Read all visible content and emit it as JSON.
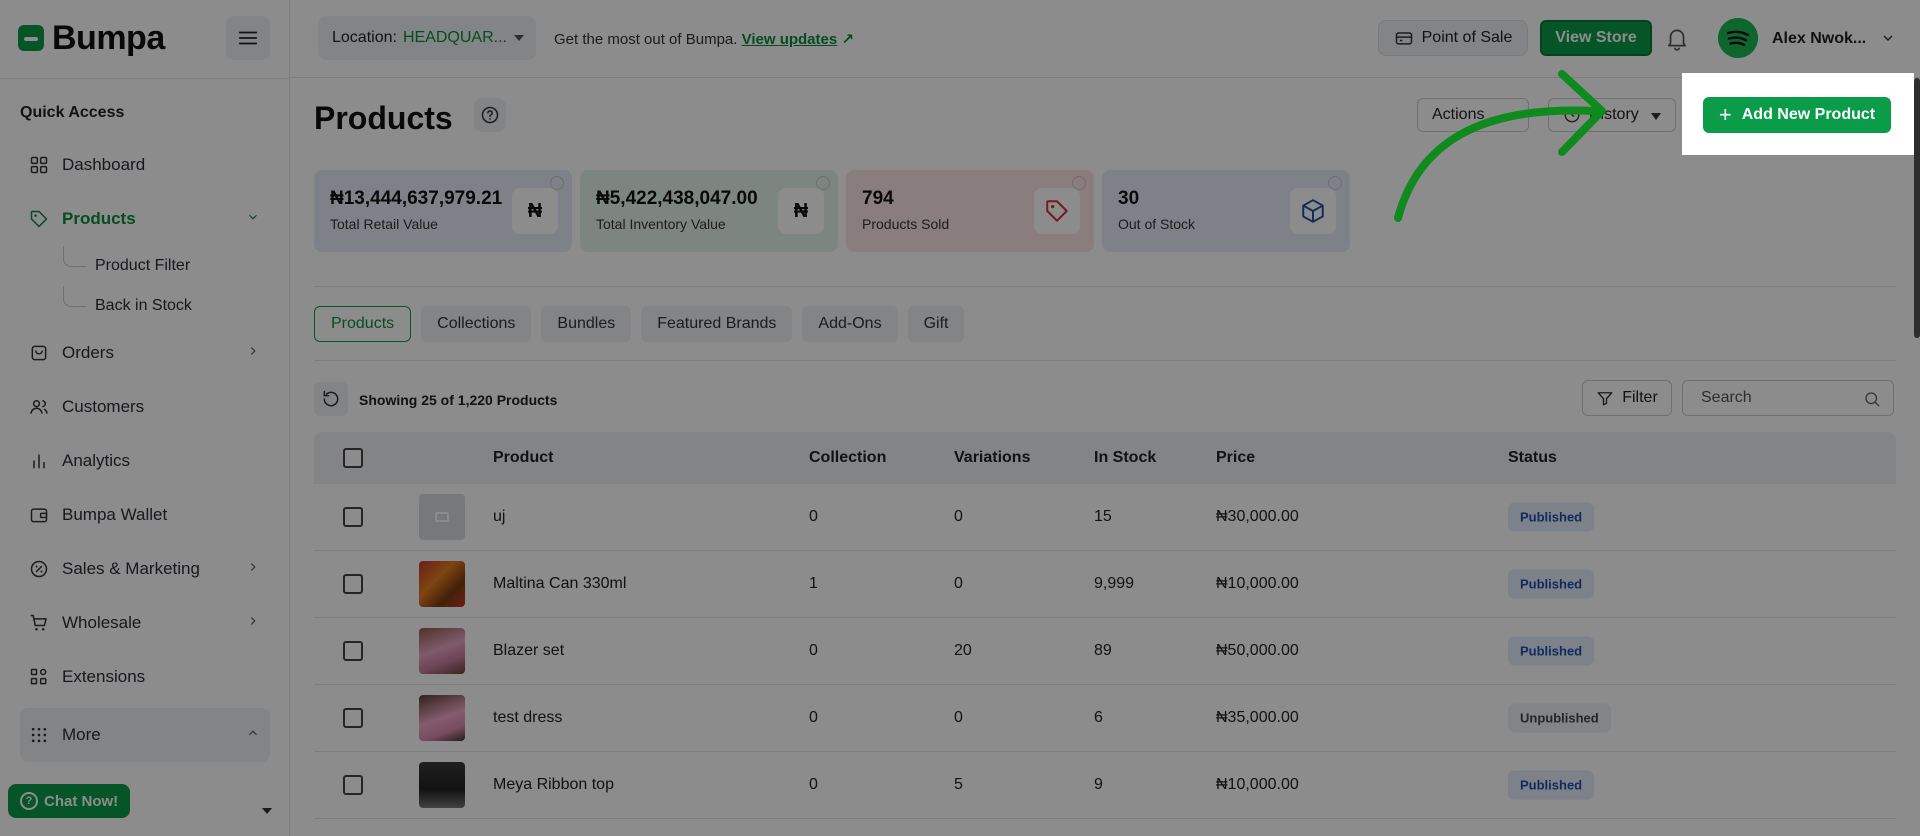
{
  "brand": {
    "name": "Bumpa"
  },
  "sidebar": {
    "quick_access_title": "Quick Access",
    "items": [
      {
        "label": "Dashboard",
        "icon": "grid-icon"
      },
      {
        "label": "Products",
        "icon": "tag-icon",
        "active": true
      },
      {
        "label": "Orders",
        "icon": "orders-icon"
      },
      {
        "label": "Customers",
        "icon": "users-icon"
      },
      {
        "label": "Analytics",
        "icon": "bar-chart-icon"
      },
      {
        "label": "Bumpa Wallet",
        "icon": "wallet-icon"
      },
      {
        "label": "Sales & Marketing",
        "icon": "percent-icon"
      },
      {
        "label": "Wholesale",
        "icon": "cart-icon"
      },
      {
        "label": "Extensions",
        "icon": "extensions-icon"
      },
      {
        "label": "More",
        "icon": "dots-grid-icon"
      }
    ],
    "sub_items": [
      "Product Filter",
      "Back in Stock"
    ],
    "chat_label": "Chat Now!"
  },
  "topbar": {
    "location_label": "Location:",
    "location_value": "HEADQUAR...",
    "promo_text": "Get the most out of Bumpa.",
    "promo_link": "View updates",
    "promo_arrow": "↗",
    "pos_label": "Point of Sale",
    "view_store_label": "View Store",
    "user_name": "Alex Nwok..."
  },
  "page": {
    "title": "Products",
    "actions_label": "Actions",
    "history_label": "History",
    "add_product_label": "Add New Product",
    "add_plus": "+"
  },
  "stats": [
    {
      "value": "₦13,444,637,979.21",
      "label": "Total Retail Value",
      "icon_text": "₦",
      "bg": "#e6ecf7"
    },
    {
      "value": "₦5,422,438,047.00",
      "label": "Total Inventory Value",
      "icon_text": "₦",
      "bg": "#e4f3ea"
    },
    {
      "value": "794",
      "label": "Products Sold",
      "icon_text": "",
      "bg": "#fbe3e5"
    },
    {
      "value": "30",
      "label": "Out of Stock",
      "icon_text": "",
      "bg": "#e6ecf7"
    }
  ],
  "tabs": [
    "Products",
    "Collections",
    "Bundles",
    "Featured Brands",
    "Add-Ons",
    "Gift"
  ],
  "list": {
    "showing_text": "Showing 25 of 1,220 Products",
    "filter_label": "Filter",
    "search_placeholder": "Search"
  },
  "table": {
    "columns": [
      "Product",
      "Collection",
      "Variations",
      "In Stock",
      "Price",
      "Status"
    ],
    "rows": [
      {
        "name": "uj",
        "collection": "0",
        "variations": "0",
        "stock": "15",
        "price": "₦30,000.00",
        "status": "Published"
      },
      {
        "name": "Maltina Can 330ml",
        "collection": "1",
        "variations": "0",
        "stock": "9,999",
        "price": "₦10,000.00",
        "status": "Published"
      },
      {
        "name": "Blazer set",
        "collection": "0",
        "variations": "20",
        "stock": "89",
        "price": "₦50,000.00",
        "status": "Published"
      },
      {
        "name": "test dress",
        "collection": "0",
        "variations": "0",
        "stock": "6",
        "price": "₦35,000.00",
        "status": "Unpublished"
      },
      {
        "name": "Meya Ribbon top",
        "collection": "0",
        "variations": "5",
        "stock": "9",
        "price": "₦10,000.00",
        "status": "Published"
      }
    ]
  },
  "colors": {
    "brand_green": "#0b9c4a",
    "published_bg": "#e3ecfb",
    "published_text": "#1f4fa8"
  }
}
